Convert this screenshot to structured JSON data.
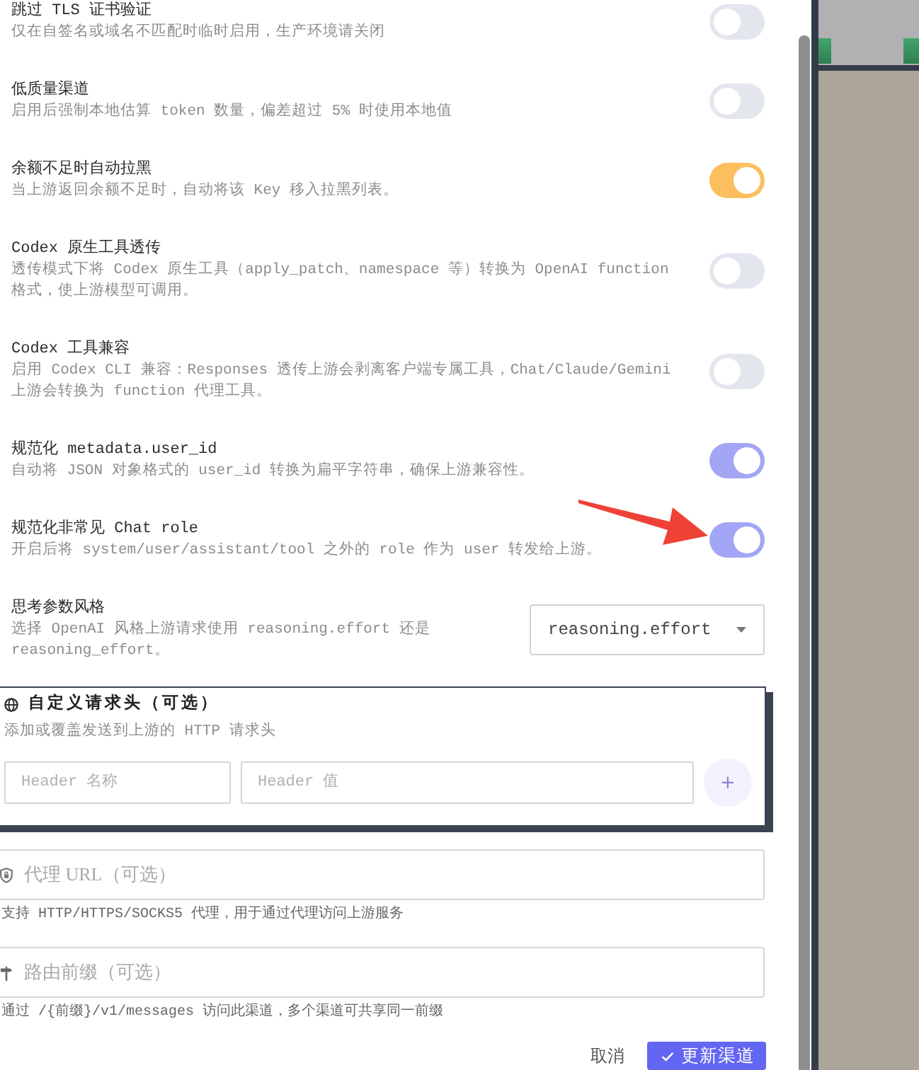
{
  "settings": [
    {
      "kind": "toggle",
      "title": "跳过 TLS 证书验证",
      "description": "仅在自签名或域名不匹配时临时启用，生产环境请关闭",
      "on": false
    },
    {
      "kind": "toggle",
      "title": "低质量渠道",
      "description": "启用后强制本地估算 token 数量，偏差超过 5% 时使用本地值",
      "on": false
    },
    {
      "kind": "toggle",
      "title": "余额不足时自动拉黑",
      "description": "当上游返回余额不足时，自动将该 Key 移入拉黑列表。",
      "on": true,
      "color": "#fcbf5f"
    },
    {
      "kind": "toggle",
      "title": "Codex 原生工具透传",
      "description": "透传模式下将 Codex 原生工具（apply_patch、namespace 等）转换为 OpenAI function 格式，使上游模型可调用。",
      "on": false
    },
    {
      "kind": "toggle",
      "title": "Codex 工具兼容",
      "description": "启用 Codex CLI 兼容：Responses 透传上游会剥离客户端专属工具，Chat/Claude/Gemini 上游会转换为 function 代理工具。",
      "on": false
    },
    {
      "kind": "toggle",
      "title": "规范化 metadata.user_id",
      "description": "自动将 JSON 对象格式的 user_id 转换为扁平字符串，确保上游兼容性。",
      "on": true,
      "color": "#a3a6f5"
    },
    {
      "kind": "toggle",
      "title": "规范化非常见 Chat role",
      "description": "开启后将 system/user/assistant/tool 之外的 role 作为 user 转发给上游。",
      "on": true,
      "color": "#a3a6f5"
    },
    {
      "kind": "select",
      "title": "思考参数风格",
      "description": "选择 OpenAI 风格上游请求使用 reasoning.effort 还是 reasoning_effort。",
      "value": "reasoning.effort"
    }
  ],
  "custom_headers": {
    "title": "自定义请求头（可选）",
    "description": "添加或覆盖发送到上游的 HTTP 请求头",
    "name_placeholder": "Header 名称",
    "value_placeholder": "Header 值",
    "add_button": "+"
  },
  "proxy": {
    "placeholder": "代理 URL（可选）",
    "hint": "支持 HTTP/HTTPS/SOCKS5 代理，用于通过代理访问上游服务"
  },
  "route_prefix": {
    "placeholder": "路由前缀（可选）",
    "hint": "通过 /{前缀}/v1/messages 访问此渠道，多个渠道可共享同一前缀"
  },
  "footer": {
    "cancel": "取消",
    "submit": "更新渠道"
  },
  "annotations": [
    {
      "kind": "arrow"
    }
  ]
}
